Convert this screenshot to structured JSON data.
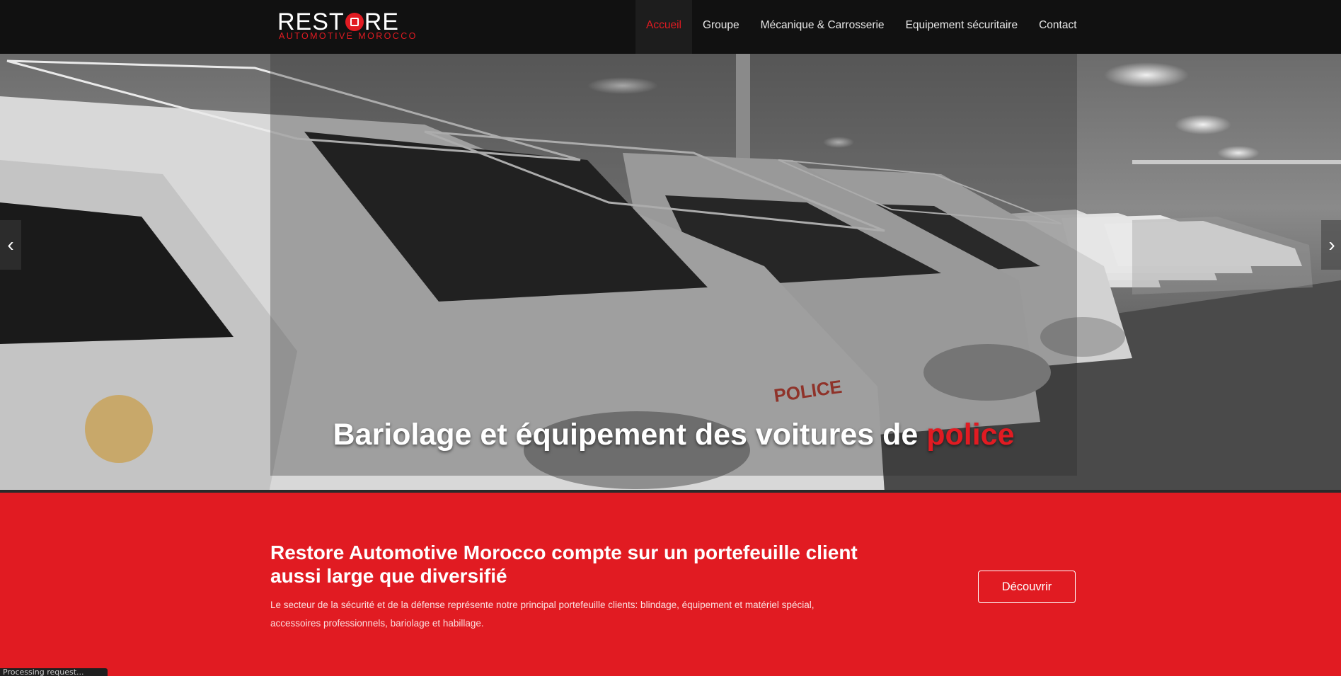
{
  "header": {
    "logo": {
      "text_before": "REST",
      "text_after": "RE",
      "subtitle": "AUTOMOTIVE MOROCCO"
    },
    "nav": [
      {
        "label": "Accueil",
        "active": true
      },
      {
        "label": "Groupe",
        "active": false
      },
      {
        "label": "Mécanique & Carrosserie",
        "active": false
      },
      {
        "label": "Equipement sécuritaire",
        "active": false
      },
      {
        "label": "Contact",
        "active": false
      }
    ]
  },
  "hero": {
    "title_main": "Bariolage et équipement des voitures de ",
    "title_highlight": "police",
    "prev_icon": "chevron-left-icon",
    "next_icon": "chevron-right-icon",
    "vehicle_text": "POLICE"
  },
  "promo": {
    "title": "Restore Automotive Morocco compte sur un portefeuille client aussi large que diversifié",
    "text": "Le secteur de la sécurité et de la défense représente notre principal portefeuille clients: blindage, équipement et matériel spécial, accessoires professionnels, bariolage et habillage.",
    "button_label": "Découvrir"
  },
  "status_bar": {
    "text": "Processing request..."
  },
  "colors": {
    "accent": "#e11b22",
    "header_bg": "#111111",
    "red_section_bg": "#e11b22"
  }
}
